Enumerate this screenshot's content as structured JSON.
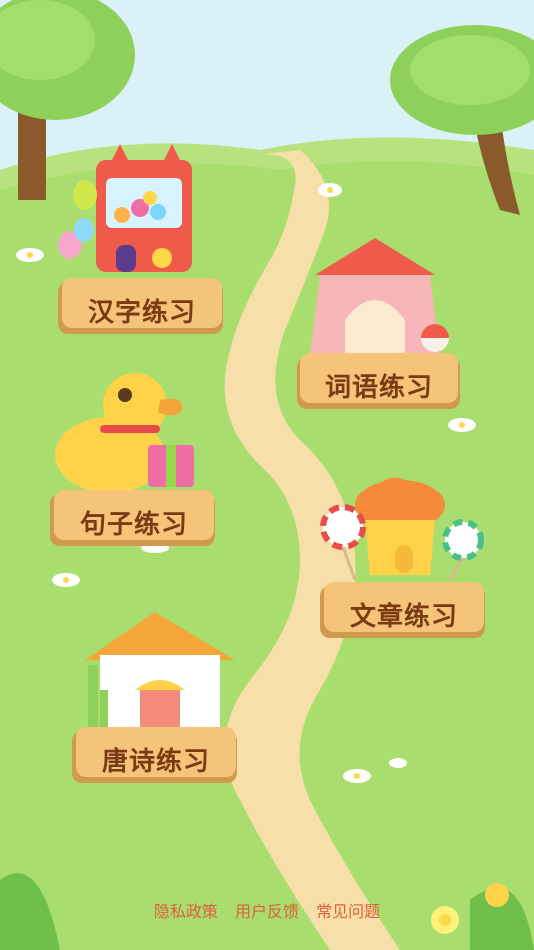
{
  "menu": {
    "items": [
      {
        "label": "汉字练习"
      },
      {
        "label": "词语练习"
      },
      {
        "label": "句子练习"
      },
      {
        "label": "文章练习"
      },
      {
        "label": "唐诗练习"
      }
    ]
  },
  "footer": {
    "links": [
      "隐私政策",
      "用户反馈",
      "常见问题"
    ]
  },
  "colors": {
    "sky": "#d9f1f7",
    "grass": "#a9dd6e",
    "path": "#f6dfa9",
    "plaque": "#f3c47a",
    "plaque_text": "#7a3b12",
    "footer_link": "#e0603a"
  }
}
